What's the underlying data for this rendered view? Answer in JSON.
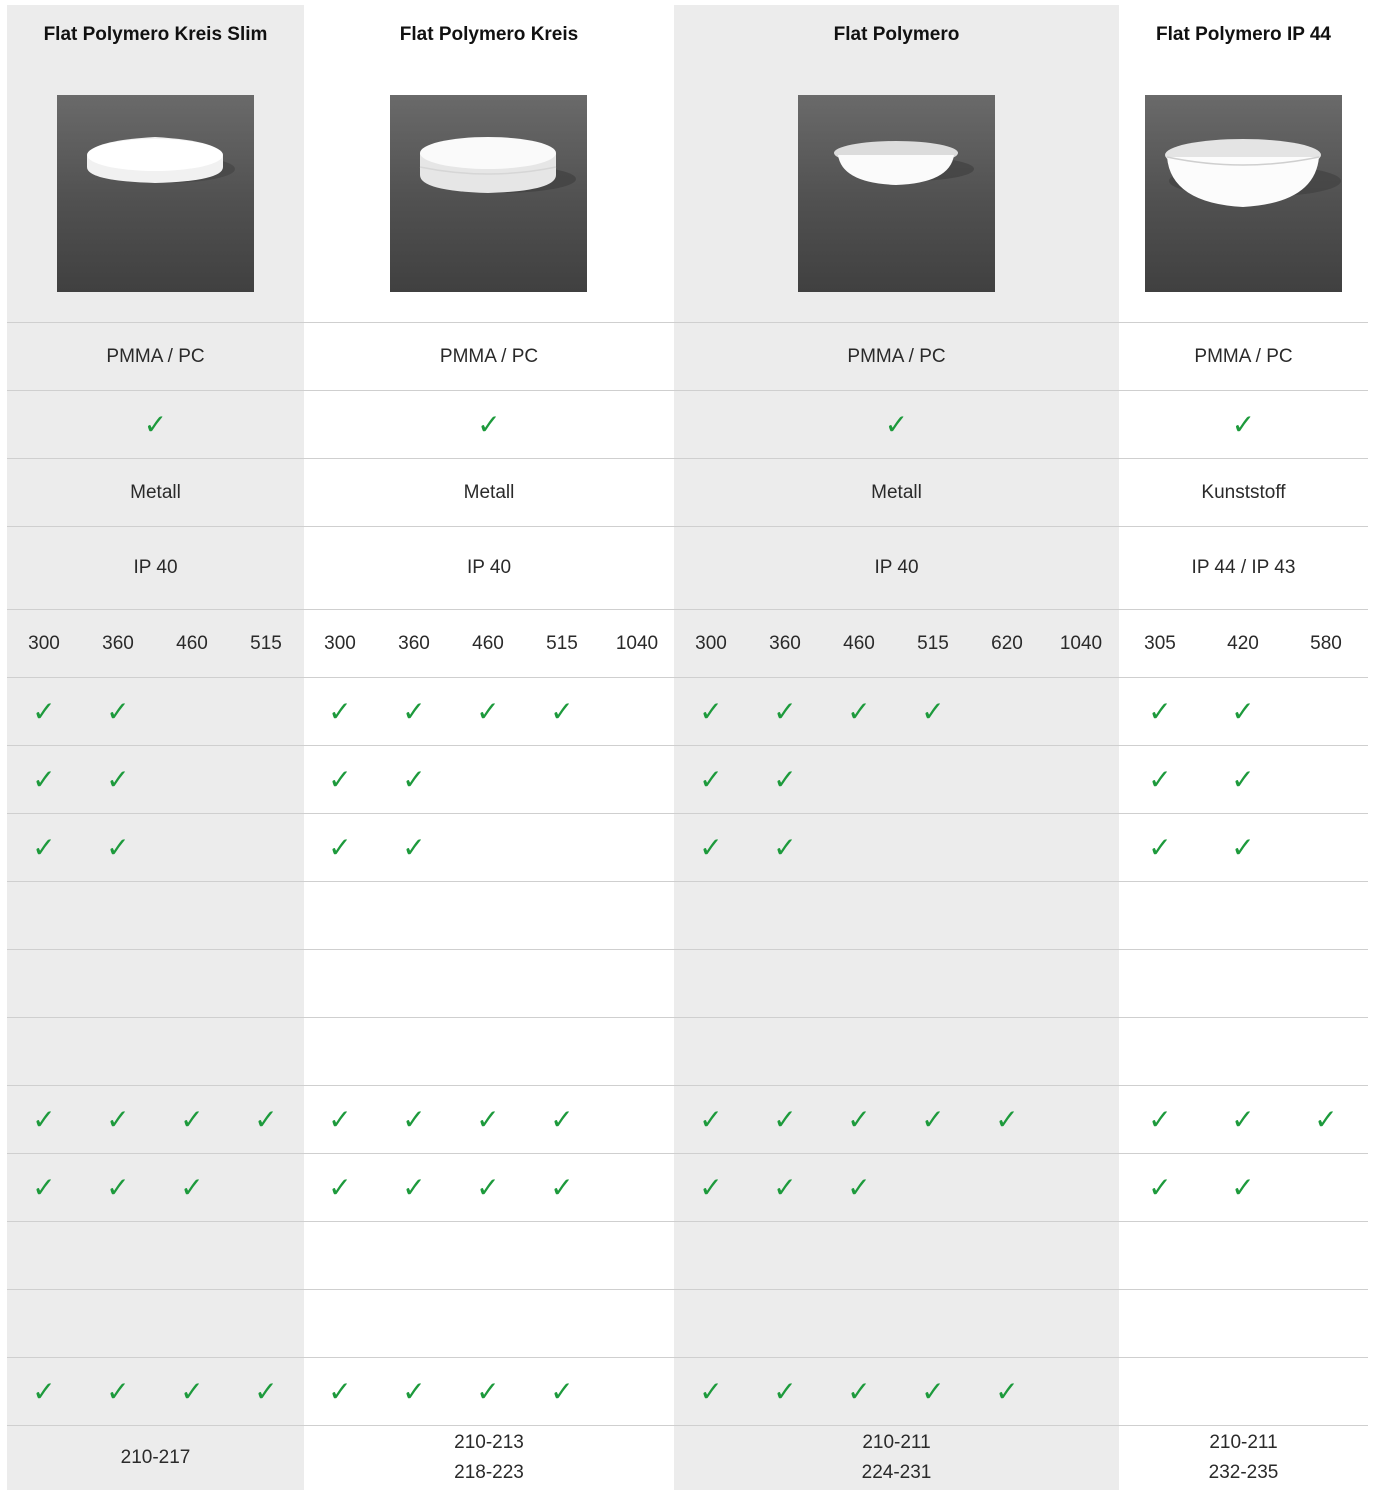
{
  "products": [
    {
      "name": "Flat Polymero Kreis Slim",
      "image": "round-slim-ceiling-luminaire",
      "diffuser": "PMMA / PC",
      "check": "✓",
      "housing": "Metall",
      "ip": "IP 40",
      "sizes": [
        "300",
        "360",
        "460",
        "515"
      ],
      "codes": [
        "210-217"
      ]
    },
    {
      "name": "Flat Polymero Kreis",
      "image": "round-ceiling-luminaire",
      "diffuser": "PMMA / PC",
      "check": "✓",
      "housing": "Metall",
      "ip": "IP 40",
      "sizes": [
        "300",
        "360",
        "460",
        "515",
        "1040"
      ],
      "codes": [
        "210-213",
        "218-223"
      ]
    },
    {
      "name": "Flat Polymero",
      "image": "dome-ceiling-luminaire",
      "diffuser": "PMMA / PC",
      "check": "✓",
      "housing": "Metall",
      "ip": "IP 40",
      "sizes": [
        "300",
        "360",
        "460",
        "515",
        "620",
        "1040"
      ],
      "codes": [
        "210-211",
        "224-231"
      ]
    },
    {
      "name": "Flat Polymero IP 44",
      "image": "deep-dome-ceiling-luminaire",
      "diffuser": "PMMA / PC",
      "check": "✓",
      "housing": "Kunststoff",
      "ip": "IP 44 / IP 43",
      "sizes": [
        "305",
        "420",
        "580"
      ],
      "codes": [
        "210-211",
        "232-235"
      ]
    }
  ],
  "check_symbol": "✓",
  "check_color": "#1d9a3c",
  "grey_band_color": "#ececec",
  "feature_rows": [
    [
      [
        true,
        true,
        false,
        false
      ],
      [
        true,
        true,
        true,
        true,
        false
      ],
      [
        true,
        true,
        true,
        true,
        false,
        false
      ],
      [
        true,
        true,
        false
      ]
    ],
    [
      [
        true,
        true,
        false,
        false
      ],
      [
        true,
        true,
        false,
        false,
        false
      ],
      [
        true,
        true,
        false,
        false,
        false,
        false
      ],
      [
        true,
        true,
        false
      ]
    ],
    [
      [
        true,
        true,
        false,
        false
      ],
      [
        true,
        true,
        false,
        false,
        false
      ],
      [
        true,
        true,
        false,
        false,
        false,
        false
      ],
      [
        true,
        true,
        false
      ]
    ],
    [
      [
        false,
        false,
        false,
        false
      ],
      [
        false,
        false,
        false,
        false,
        false
      ],
      [
        false,
        false,
        false,
        false,
        false,
        false
      ],
      [
        false,
        false,
        false
      ]
    ],
    [
      [
        false,
        false,
        false,
        false
      ],
      [
        false,
        false,
        false,
        false,
        false
      ],
      [
        false,
        false,
        false,
        false,
        false,
        false
      ],
      [
        false,
        false,
        false
      ]
    ],
    [
      [
        false,
        false,
        false,
        false
      ],
      [
        false,
        false,
        false,
        false,
        false
      ],
      [
        false,
        false,
        false,
        false,
        false,
        false
      ],
      [
        false,
        false,
        false
      ]
    ],
    [
      [
        true,
        true,
        true,
        true
      ],
      [
        true,
        true,
        true,
        true,
        false
      ],
      [
        true,
        true,
        true,
        true,
        true,
        false
      ],
      [
        true,
        true,
        true
      ]
    ],
    [
      [
        true,
        true,
        true,
        false
      ],
      [
        true,
        true,
        true,
        true,
        false
      ],
      [
        true,
        true,
        true,
        false,
        false,
        false
      ],
      [
        true,
        true,
        false
      ]
    ],
    [
      [
        false,
        false,
        false,
        false
      ],
      [
        false,
        false,
        false,
        false,
        false
      ],
      [
        false,
        false,
        false,
        false,
        false,
        false
      ],
      [
        false,
        false,
        false
      ]
    ],
    [
      [
        false,
        false,
        false,
        false
      ],
      [
        false,
        false,
        false,
        false,
        false
      ],
      [
        false,
        false,
        false,
        false,
        false,
        false
      ],
      [
        false,
        false,
        false
      ]
    ],
    [
      [
        true,
        true,
        true,
        true
      ],
      [
        true,
        true,
        true,
        true,
        false
      ],
      [
        true,
        true,
        true,
        true,
        true,
        false
      ],
      [
        false,
        false,
        false
      ]
    ]
  ]
}
